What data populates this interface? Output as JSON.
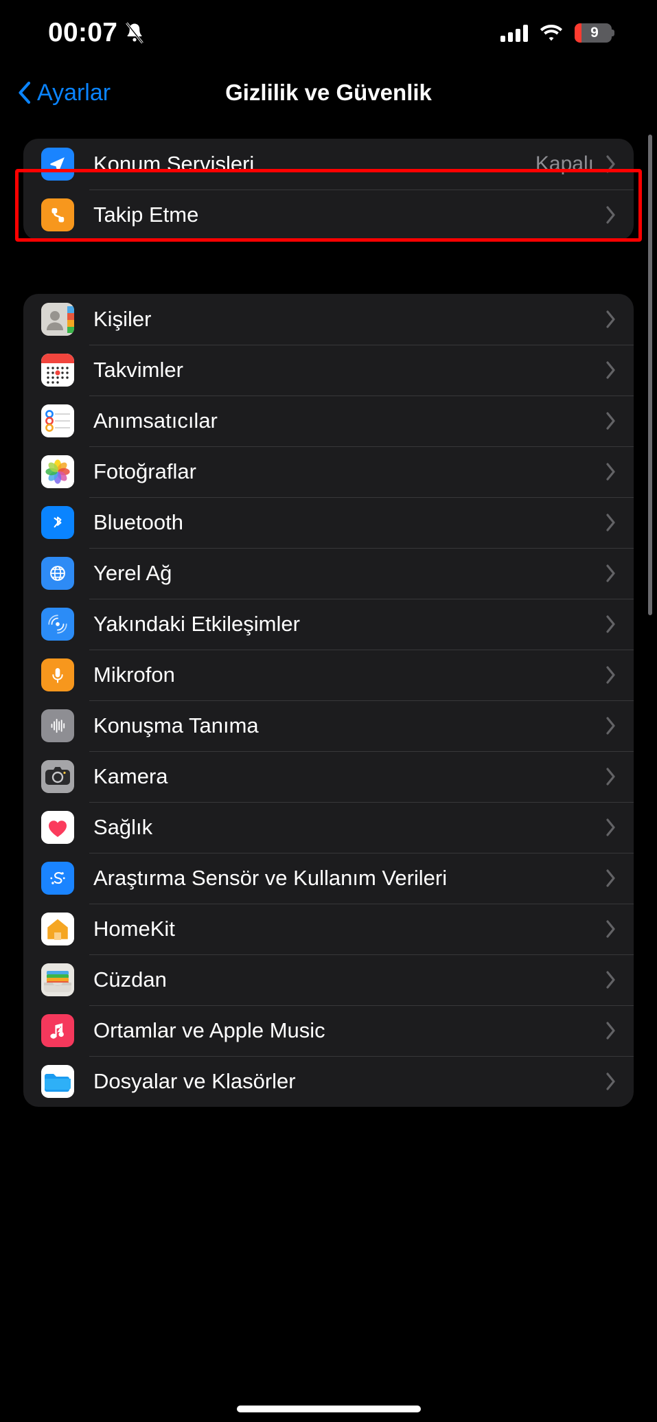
{
  "status_bar": {
    "time": "00:07",
    "bell_icon": "bell-slash-icon",
    "signal_icon": "cellular-signal-icon",
    "wifi_icon": "wifi-icon",
    "battery_percent": "9",
    "battery_color": "#ff3b30"
  },
  "nav": {
    "back_label": "Ayarlar",
    "back_icon": "chevron-left-icon",
    "title": "Gizlilik ve Güvenlik"
  },
  "accent_color": "#0a84ff",
  "highlight_color": "#ff0000",
  "group_highlighted": {
    "rows": [
      {
        "label": "Konum Servisleri",
        "value": "Kapalı",
        "icon": "location-arrow-icon",
        "icon_class": "ic-loc"
      },
      {
        "label": "Takip Etme",
        "value": "",
        "icon": "tracking-icon",
        "icon_class": "ic-track"
      }
    ]
  },
  "group_apps": {
    "rows": [
      {
        "label": "Kişiler",
        "value": "",
        "icon": "contacts-icon",
        "icon_class": "ic-contacts"
      },
      {
        "label": "Takvimler",
        "value": "",
        "icon": "calendar-icon",
        "icon_class": "ic-cal"
      },
      {
        "label": "Anımsatıcılar",
        "value": "",
        "icon": "reminders-icon",
        "icon_class": "ic-remind"
      },
      {
        "label": "Fotoğraflar",
        "value": "",
        "icon": "photos-icon",
        "icon_class": "ic-photos"
      },
      {
        "label": "Bluetooth",
        "value": "",
        "icon": "bluetooth-icon",
        "icon_class": "ic-bt"
      },
      {
        "label": "Yerel Ağ",
        "value": "",
        "icon": "local-network-globe-icon",
        "icon_class": "ic-net"
      },
      {
        "label": "Yakındaki Etkileşimler",
        "value": "",
        "icon": "nearby-interactions-icon",
        "icon_class": "ic-nearby"
      },
      {
        "label": "Mikrofon",
        "value": "",
        "icon": "microphone-icon",
        "icon_class": "ic-mic"
      },
      {
        "label": "Konuşma Tanıma",
        "value": "",
        "icon": "speech-recognition-icon",
        "icon_class": "ic-speech"
      },
      {
        "label": "Kamera",
        "value": "",
        "icon": "camera-icon",
        "icon_class": "ic-cam"
      },
      {
        "label": "Sağlık",
        "value": "",
        "icon": "health-heart-icon",
        "icon_class": "ic-health"
      },
      {
        "label": "Araştırma Sensör ve Kullanım Verileri",
        "value": "",
        "icon": "research-sensor-icon",
        "icon_class": "ic-research"
      },
      {
        "label": "HomeKit",
        "value": "",
        "icon": "homekit-house-icon",
        "icon_class": "ic-home"
      },
      {
        "label": "Cüzdan",
        "value": "",
        "icon": "wallet-icon",
        "icon_class": "ic-wallet"
      },
      {
        "label": "Ortamlar ve Apple Music",
        "value": "",
        "icon": "music-note-icon",
        "icon_class": "ic-music"
      },
      {
        "label": "Dosyalar ve Klasörler",
        "value": "",
        "icon": "files-folder-icon",
        "icon_class": "ic-files"
      }
    ]
  }
}
